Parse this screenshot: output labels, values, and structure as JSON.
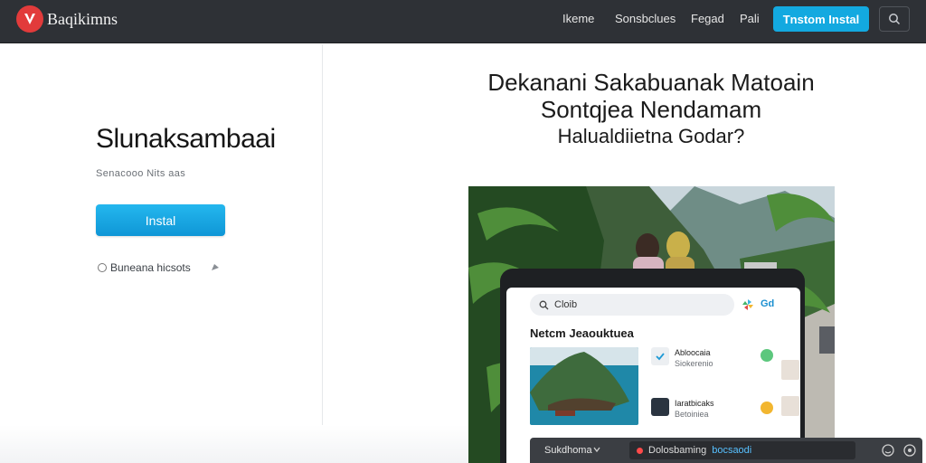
{
  "header": {
    "brand": "Baqikimns",
    "nav": [
      "Ikeme",
      "Sonsbclues",
      "Fegad",
      "Pali"
    ],
    "install_label": "Tnstom Instal",
    "icons": {
      "logo": "brand-logo-icon",
      "search": "search-icon"
    }
  },
  "left": {
    "title": "Slunaksambaai",
    "subtitle": "Senacooo Nits aas",
    "install_label": "Instal",
    "link_label": "Buneana hicsots"
  },
  "hero": {
    "line1": "Dekanani Sakabuanak Matoain",
    "line2": "Sontqjea Nendamam",
    "line3": "Halualdiietna Godar?"
  },
  "app": {
    "search_text": "Cloib",
    "badge": "Gd",
    "heading": "Netcm Jeaouktuea",
    "items": [
      {
        "title": "Abloocaia",
        "sub": "Siokerenio"
      },
      {
        "title": "Iaratbicaks",
        "sub": "Betoiniea"
      }
    ],
    "bottom_left": "Sukdhoma",
    "bottom_field_a": "Dolosbaming",
    "bottom_field_b": "bocsaodi"
  },
  "colors": {
    "accent": "#13a9e0",
    "nav_bg": "#2e3136",
    "brand_red": "#e23b3b"
  }
}
